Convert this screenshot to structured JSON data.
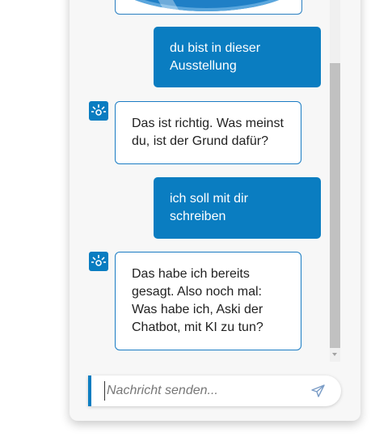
{
  "conversation": {
    "messages": [
      {
        "sender": "user",
        "text": "du bist in dieser Ausstellung"
      },
      {
        "sender": "bot",
        "text": "Das ist richtig. Was meinst du, ist der Grund dafür?"
      },
      {
        "sender": "user",
        "text": "ich soll mit dir schreiben"
      },
      {
        "sender": "bot",
        "text": "Das habe ich bereits gesagt. Also noch mal: Was habe ich, Aski der Chatbot, mit KI zu tun?"
      }
    ],
    "bot_avatar_icon": "bot-logo-icon"
  },
  "composer": {
    "placeholder": "Nachricht senden...",
    "value": "",
    "send_icon": "paper-plane-icon"
  },
  "colors": {
    "accent": "#0a7dc1",
    "bot_bubble_border": "#1a7cc4",
    "panel_bg": "#f7f7f7"
  }
}
